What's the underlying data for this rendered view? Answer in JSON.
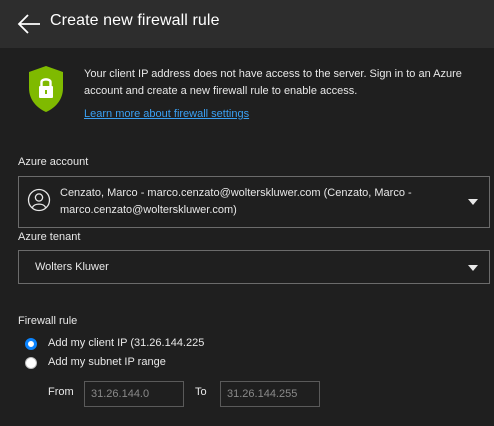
{
  "header": {
    "title": "Create new firewall rule",
    "back_icon": "arrow-left-icon"
  },
  "notice": {
    "icon": "shield-lock-icon",
    "shield_color": "#7fba00",
    "message": "Your client IP address does not have access to the server. Sign in to an Azure account and create a new firewall rule to enable access.",
    "link_text": "Learn more about firewall settings"
  },
  "account": {
    "label": "Azure account",
    "selected": "Cenzato, Marco - marco.cenzato@wolterskluwer.com (Cenzato, Marco - marco.cenzato@wolterskluwer.com)",
    "avatar_icon": "user-circle-icon"
  },
  "tenant": {
    "label": "Azure tenant",
    "selected": "Wolters Kluwer"
  },
  "firewall": {
    "label": "Firewall rule",
    "options": [
      {
        "label": "Add my client IP (31.26.144.225",
        "selected": true
      },
      {
        "label": "Add my subnet IP range",
        "selected": false
      }
    ],
    "from_label": "From",
    "from_value": "31.26.144.0",
    "to_label": "To",
    "to_value": "31.26.144.255"
  },
  "colors": {
    "background": "#1f1f1f",
    "header": "#2d2d2d",
    "accent": "#0a84ff",
    "link": "#3aa0f3"
  }
}
